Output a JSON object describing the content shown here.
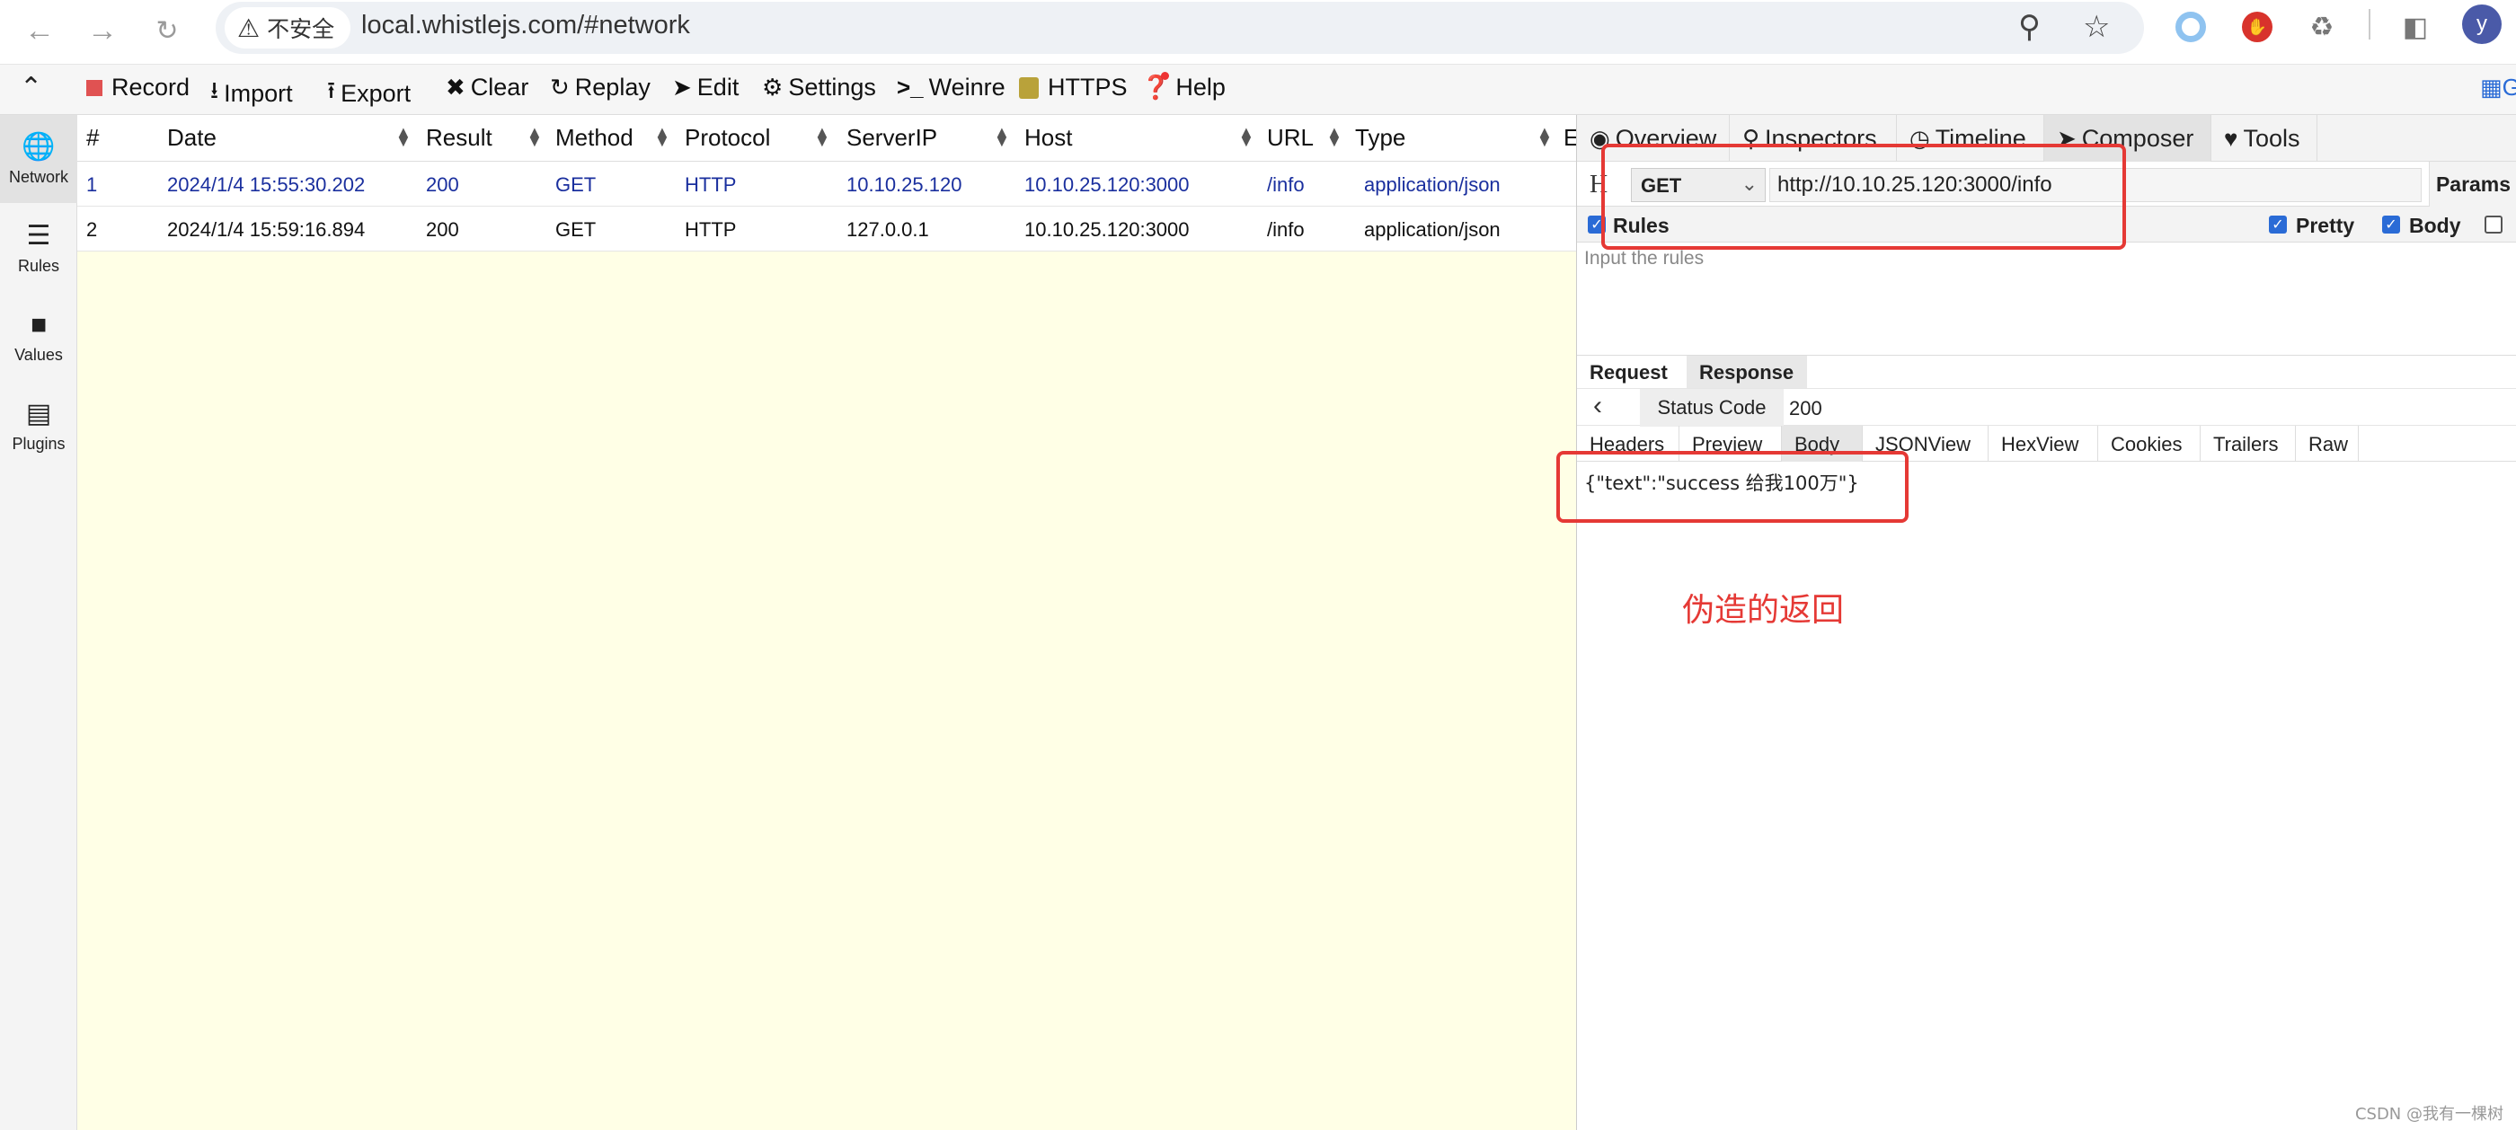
{
  "browser": {
    "back_icon": "arrow-left-icon",
    "forward_icon": "arrow-right-icon",
    "reload_icon": "reload-icon",
    "security_label": "不安全",
    "url": "local.whistlejs.com/#network",
    "avatar_letter": "y"
  },
  "toolbar": {
    "items": [
      {
        "label": "Record",
        "icon": "record-icon"
      },
      {
        "label": "Import",
        "icon": "import-icon"
      },
      {
        "label": "Export",
        "icon": "export-icon"
      },
      {
        "label": "Clear",
        "icon": "close-icon"
      },
      {
        "label": "Replay",
        "icon": "replay-icon"
      },
      {
        "label": "Edit",
        "icon": "send-icon"
      },
      {
        "label": "Settings",
        "icon": "gear-icon"
      },
      {
        "label": "Weinre",
        "icon": "terminal-icon"
      },
      {
        "label": "HTTPS",
        "icon": "lock-icon"
      },
      {
        "label": "Help",
        "icon": "question-icon"
      }
    ],
    "right_label": "G"
  },
  "sidebar": {
    "items": [
      {
        "label": "Network",
        "icon": "globe-icon"
      },
      {
        "label": "Rules",
        "icon": "list-icon"
      },
      {
        "label": "Values",
        "icon": "folder-icon"
      },
      {
        "label": "Plugins",
        "icon": "plugin-icon"
      }
    ]
  },
  "network": {
    "columns": [
      "#",
      "Date",
      "Result",
      "Method",
      "Protocol",
      "ServerIP",
      "Host",
      "URL",
      "Type",
      "E"
    ],
    "rows": [
      {
        "num": "1",
        "date": "2024/1/4 15:55:30.202",
        "result": "200",
        "method": "GET",
        "protocol": "HTTP",
        "server_ip": "10.10.25.120",
        "host": "10.10.25.120:3000",
        "url": "/info",
        "type": "application/json"
      },
      {
        "num": "2",
        "date": "2024/1/4 15:59:16.894",
        "result": "200",
        "method": "GET",
        "protocol": "HTTP",
        "server_ip": "127.0.0.1",
        "host": "10.10.25.120:3000",
        "url": "/info",
        "type": "application/json"
      }
    ]
  },
  "panel": {
    "tabs": [
      {
        "label": "Overview",
        "icon": "eye-icon"
      },
      {
        "label": "Inspectors",
        "icon": "search-icon"
      },
      {
        "label": "Timeline",
        "icon": "clock-icon"
      },
      {
        "label": "Composer",
        "icon": "send-icon"
      },
      {
        "label": "Tools",
        "icon": "heart-icon"
      }
    ],
    "composer": {
      "history_icon": "H",
      "method": "GET",
      "url": "http://10.10.25.120:3000/info",
      "params_label": "Params",
      "rules_label": "Rules",
      "pretty_label": "Pretty",
      "body_label": "Body",
      "rules_placeholder": "Input the rules"
    },
    "result": {
      "request_tab": "Request",
      "response_tab": "Response",
      "status_key": "Status Code",
      "status_value": "200",
      "sub_tabs": [
        "Headers",
        "Preview",
        "Body",
        "JSONView",
        "HexView",
        "Cookies",
        "Trailers",
        "Raw"
      ],
      "body": "{\"text\":\"success 给我100万\"}"
    }
  },
  "annotation": {
    "text": "伪造的返回",
    "color": "#e53935"
  },
  "watermark": "CSDN @我有一棵树"
}
